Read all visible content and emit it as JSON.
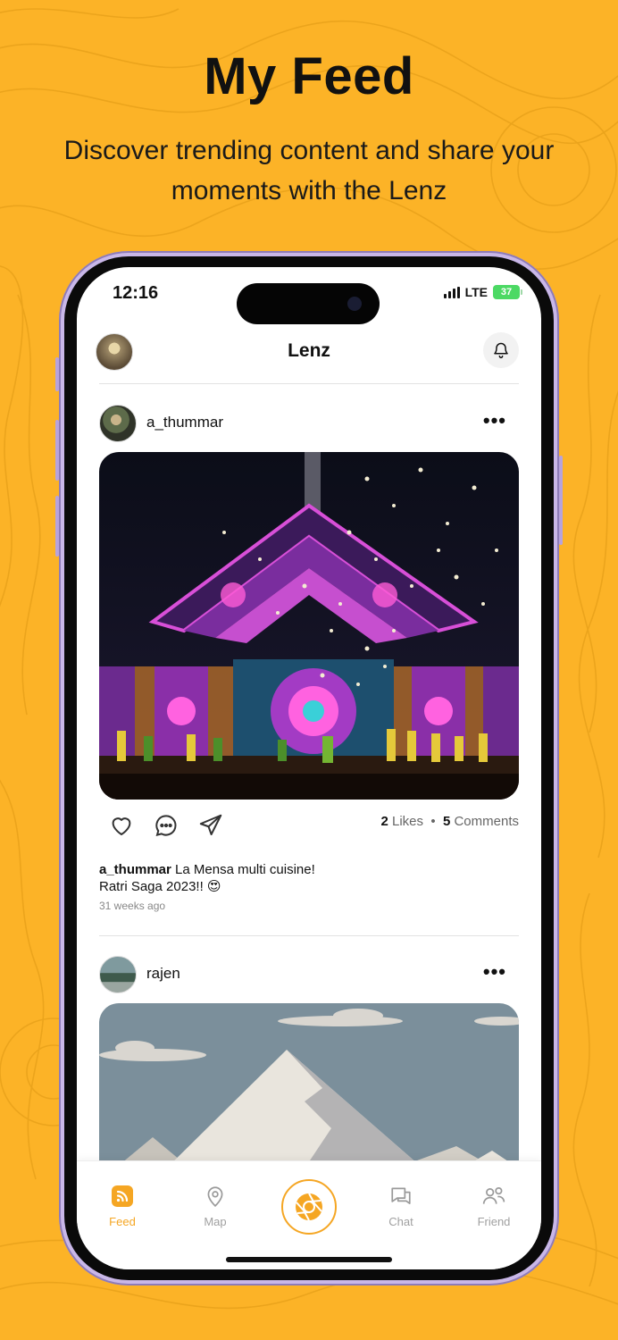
{
  "hero": {
    "title": "My Feed",
    "subtitle": "Discover trending content and share your moments with the Lenz"
  },
  "status_bar": {
    "time": "12:16",
    "network": "LTE",
    "battery": "37"
  },
  "header": {
    "title": "Lenz",
    "avatar_icon": "profile-avatar",
    "bell_icon": "bell-icon"
  },
  "posts": [
    {
      "username": "a_thummar",
      "image": "concert-stage-photo",
      "likes_count": "2",
      "likes_label": "Likes",
      "comments_count": "5",
      "comments_label": "Comments",
      "caption_user": "a_thummar",
      "caption_text": "La Mensa multi cuisine!",
      "caption_line2": "Ratri Saga 2023!! 😍",
      "time_ago": "31 weeks ago"
    },
    {
      "username": "rajen",
      "image": "mountain-illustration"
    }
  ],
  "tabs": [
    {
      "label": "Feed",
      "icon": "feed-icon",
      "active": true
    },
    {
      "label": "Map",
      "icon": "map-pin-icon",
      "active": false
    },
    {
      "label": "",
      "icon": "camera-shutter-icon",
      "active": false
    },
    {
      "label": "Chat",
      "icon": "chat-icon",
      "active": false
    },
    {
      "label": "Friend",
      "icon": "friends-icon",
      "active": false
    }
  ],
  "colors": {
    "background": "#FCB327",
    "accent": "#F5A623",
    "text": "#111111"
  }
}
